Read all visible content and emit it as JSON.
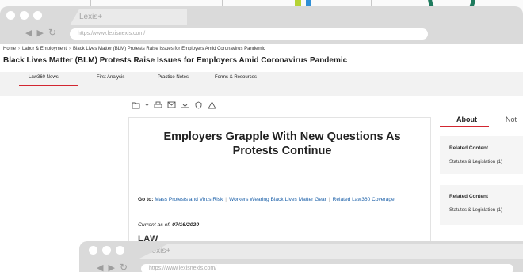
{
  "browser": {
    "tab_label": "Lexis+",
    "url": "https://www.lexisnexis.com/"
  },
  "breadcrumb": [
    "Home",
    "Labor & Employment",
    "Black Lives Matter (BLM) Protests Raise Issues for Employers Amid Coronavirus Pandemic"
  ],
  "document_title": "Black Lives Matter (BLM) Protests Raise Issues for Employers Amid Coronavirus Pandemic",
  "content_tabs": [
    "Law360 News",
    "First Analysis",
    "Practice Notes",
    "Forms & Resources"
  ],
  "active_tab": "Law360 News",
  "article": {
    "title": "Employers Grapple With New Questions As Protests Continue",
    "goto_label": "Go to:",
    "goto_links": [
      "Mass Protests and Virus Risk",
      "Workers Wearing Black Lives Matter Gear",
      "Related Law360 Coverage"
    ],
    "current_label": "Current as of:",
    "current_date": "07/16/2020",
    "logo_text": "LAW"
  },
  "sidebar": {
    "tabs": [
      "About",
      "Not"
    ],
    "panels": [
      {
        "heading": "Related Content",
        "item": "Statutes & Legislation (1)"
      },
      {
        "heading": "Related Content",
        "item": "Statutes & Legislation (1)"
      }
    ]
  },
  "browser2": {
    "tab_label": "Lexis+",
    "url": "https://www.lexisnexis.com/"
  },
  "colors": {
    "accent": "#d22630",
    "link": "#1a5fa8",
    "chrome": "#dadada"
  }
}
